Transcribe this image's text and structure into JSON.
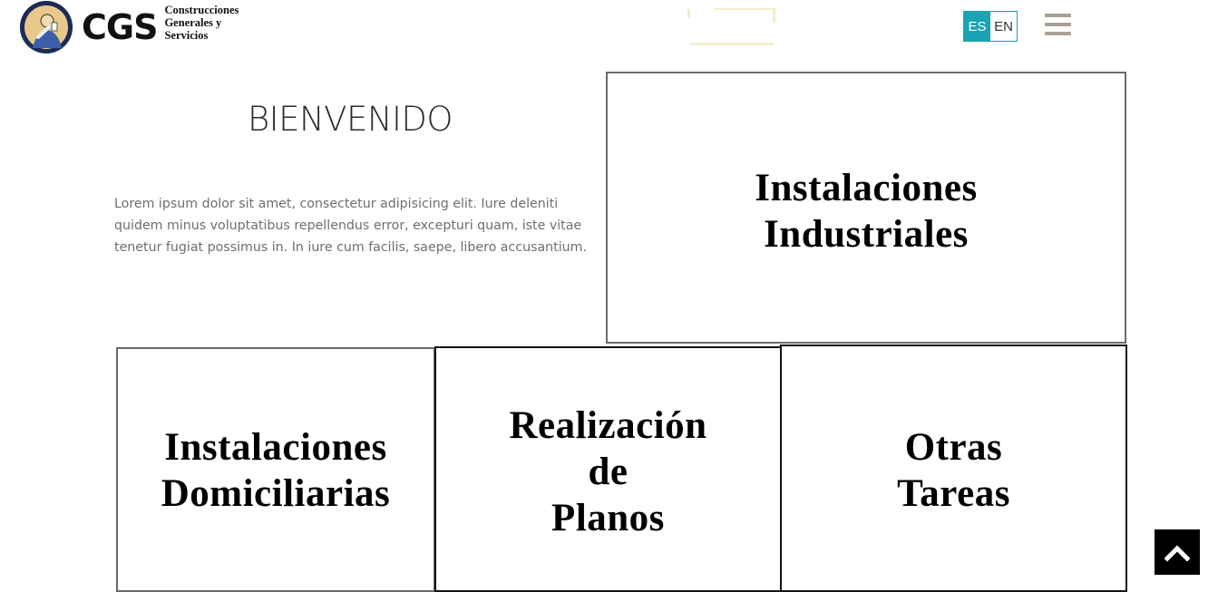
{
  "header": {
    "logo": {
      "brand": "CGS",
      "subtitle": "Construcciones\nGenerales y\nServicios"
    },
    "language": {
      "options": [
        "ES",
        "EN"
      ],
      "active": "ES"
    },
    "menu_icon": "hamburger-menu-icon"
  },
  "welcome": {
    "title": "BIENVENIDO",
    "text": "Lorem ipsum dolor sit amet, consectetur adipisicing elit. Iure deleniti quidem minus voluptatibus repellendus error, excepturi quam, iste vitae tenetur fugiat possimus in. In iure cum facilis, saepe, libero accusantium."
  },
  "services": {
    "industriales": "Instalaciones\nIndustriales",
    "domiciliarias": "Instalaciones\nDomiciliarias",
    "planos": "Realización\nde\nPlanos",
    "otras": "Otras\nTareas"
  },
  "back_to_top_icon": "chevron-up-icon",
  "colors": {
    "accent": "#1aa3b5",
    "menu_icon": "#a9a096",
    "text_muted": "#6e6e6e",
    "back_to_top_bg": "#000000"
  }
}
